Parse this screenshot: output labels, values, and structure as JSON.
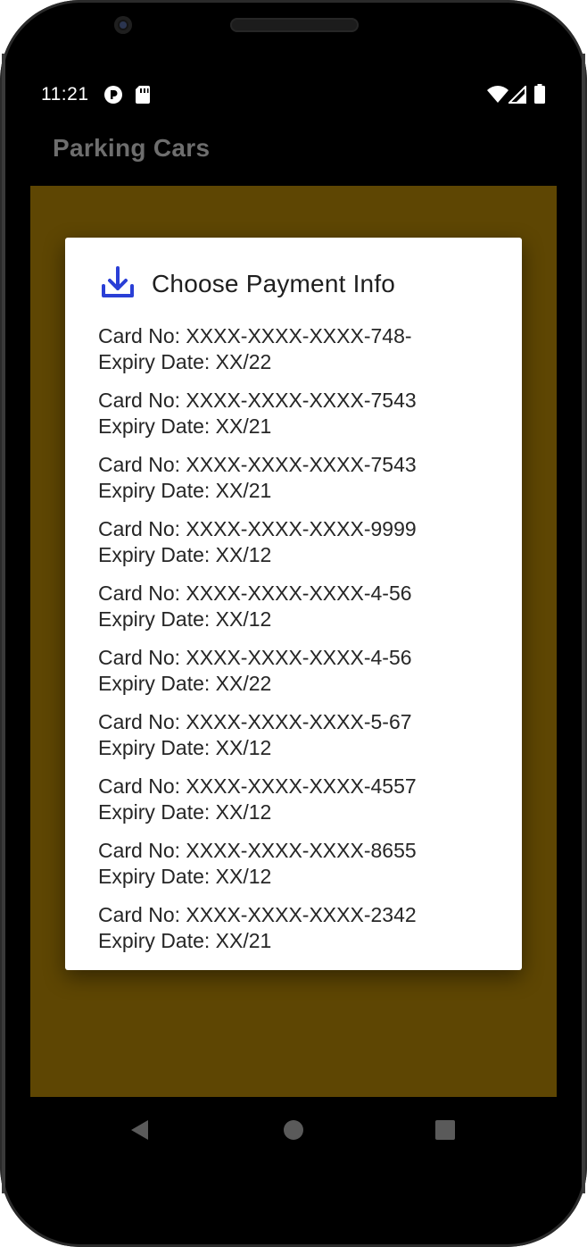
{
  "status_bar": {
    "time": "11:21",
    "icons": [
      "app-notification-icon",
      "sd-card-icon",
      "wifi-icon",
      "signal-icon",
      "battery-icon"
    ]
  },
  "app_bar": {
    "title": "Parking Cars"
  },
  "dialog": {
    "icon": "download-icon",
    "title": "Choose Payment Info",
    "cards": [
      {
        "card_no": "Card No: XXXX-XXXX-XXXX-748-",
        "expiry": "Expiry Date: XX/22"
      },
      {
        "card_no": "Card No: XXXX-XXXX-XXXX-7543",
        "expiry": "Expiry Date: XX/21"
      },
      {
        "card_no": "Card No: XXXX-XXXX-XXXX-7543",
        "expiry": "Expiry Date: XX/21"
      },
      {
        "card_no": "Card No: XXXX-XXXX-XXXX-9999",
        "expiry": "Expiry Date: XX/12"
      },
      {
        "card_no": "Card No: XXXX-XXXX-XXXX-4-56",
        "expiry": "Expiry Date: XX/12"
      },
      {
        "card_no": "Card No: XXXX-XXXX-XXXX-4-56",
        "expiry": "Expiry Date: XX/22"
      },
      {
        "card_no": "Card No: XXXX-XXXX-XXXX-5-67",
        "expiry": "Expiry Date: XX/12"
      },
      {
        "card_no": "Card No: XXXX-XXXX-XXXX-4557",
        "expiry": "Expiry Date: XX/12"
      },
      {
        "card_no": "Card No: XXXX-XXXX-XXXX-8655",
        "expiry": "Expiry Date: XX/12"
      },
      {
        "card_no": "Card No: XXXX-XXXX-XXXX-2342",
        "expiry": "Expiry Date: XX/21"
      }
    ]
  },
  "nav_bar": {
    "buttons": [
      "back-icon",
      "home-icon",
      "recents-icon"
    ]
  },
  "colors": {
    "content_background": "#5e4603",
    "dialog_icon": "#2a3fd6",
    "app_title": "#6e6e6e"
  }
}
